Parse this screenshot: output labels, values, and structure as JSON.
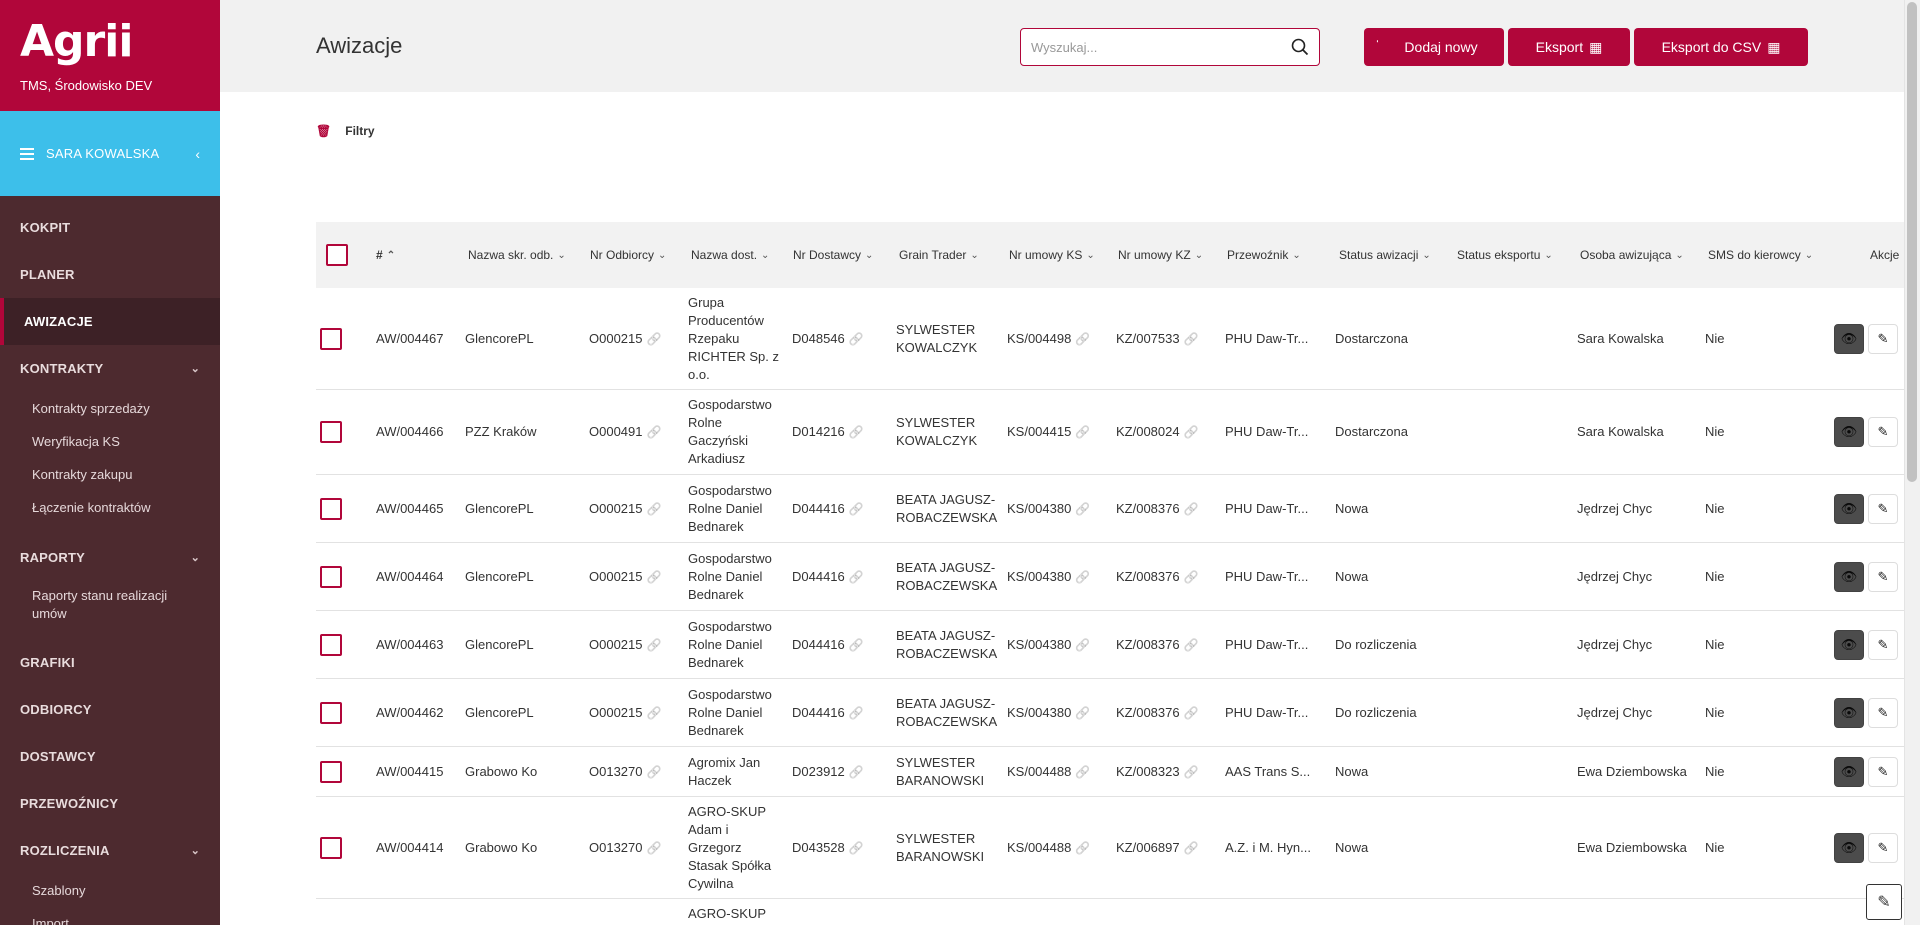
{
  "brand": {
    "logo": "Agrii",
    "env": "TMS, Środowisko DEV",
    "accent": "#b1063a",
    "user_bar_color": "#3dbfea",
    "sidebar_color": "#4d2a2f"
  },
  "user": {
    "name": "SARA KOWALSKA"
  },
  "nav": {
    "kokpit": "KOKPIT",
    "planer": "PLANER",
    "awizacje": "AWIZACJE",
    "kontrakty": "KONTRAKTY",
    "kontrakty_sub": [
      "Kontrakty sprzedaży",
      "Weryfikacja KS",
      "Kontrakty zakupu",
      "Łączenie kontraktów"
    ],
    "raporty": "RAPORTY",
    "raporty_sub": [
      "Raporty stanu realizacji umów"
    ],
    "grafiki": "GRAFIKI",
    "odbiorcy": "ODBIORCY",
    "dostawcy": "DOSTAWCY",
    "przewoznicy": "PRZEWOŹNICY",
    "rozliczenia": "ROZLICZENIA",
    "rozliczenia_sub": [
      "Szablony",
      "Import"
    ]
  },
  "header": {
    "title": "Awizacje",
    "search_placeholder": "Wyszukaj...",
    "add_label": "Dodaj nowy",
    "export_label": "Eksport",
    "export_csv_label": "Eksport do CSV"
  },
  "filters": {
    "label": "Filtry"
  },
  "table": {
    "columns": [
      "#",
      "Nazwa skr. odb.",
      "Nr Odbiorcy",
      "Nazwa dost.",
      "Nr Dostawcy",
      "Grain Trader",
      "Nr umowy KS",
      "Nr umowy KZ",
      "Przewoźnik",
      "Status awizacji",
      "Status eksportu",
      "Osoba awizująca",
      "SMS do kierowcy",
      "Akcje"
    ],
    "rows": [
      {
        "id": "AW/004467",
        "odb": "GlencorePL",
        "nr_odb": "O000215",
        "dost": "Grupa Producentów Rzepaku RICHTER Sp. z o.o.",
        "nr_dost": "D048546",
        "trader": "SYLWESTER KOWALCZYK",
        "ks": "KS/004498",
        "kz": "KZ/007533",
        "przew": "PHU Daw-Tr...",
        "status": "Dostarczona",
        "eksport": "",
        "osoba": "Sara Kowalska",
        "sms": "Nie"
      },
      {
        "id": "AW/004466",
        "odb": "PZZ Kraków",
        "nr_odb": "O000491",
        "dost": "Gospodarstwo Rolne Gaczyński Arkadiusz",
        "nr_dost": "D014216",
        "trader": "SYLWESTER KOWALCZYK",
        "ks": "KS/004415",
        "kz": "KZ/008024",
        "przew": "PHU Daw-Tr...",
        "status": "Dostarczona",
        "eksport": "",
        "osoba": "Sara Kowalska",
        "sms": "Nie"
      },
      {
        "id": "AW/004465",
        "odb": "GlencorePL",
        "nr_odb": "O000215",
        "dost": "Gospodarstwo Rolne Daniel Bednarek",
        "nr_dost": "D044416",
        "trader": "BEATA JAGUSZ-ROBACZEWSKA",
        "ks": "KS/004380",
        "kz": "KZ/008376",
        "przew": "PHU Daw-Tr...",
        "status": "Nowa",
        "eksport": "",
        "osoba": "Jędrzej Chyc",
        "sms": "Nie"
      },
      {
        "id": "AW/004464",
        "odb": "GlencorePL",
        "nr_odb": "O000215",
        "dost": "Gospodarstwo Rolne Daniel Bednarek",
        "nr_dost": "D044416",
        "trader": "BEATA JAGUSZ-ROBACZEWSKA",
        "ks": "KS/004380",
        "kz": "KZ/008376",
        "przew": "PHU Daw-Tr...",
        "status": "Nowa",
        "eksport": "",
        "osoba": "Jędrzej Chyc",
        "sms": "Nie"
      },
      {
        "id": "AW/004463",
        "odb": "GlencorePL",
        "nr_odb": "O000215",
        "dost": "Gospodarstwo Rolne Daniel Bednarek",
        "nr_dost": "D044416",
        "trader": "BEATA JAGUSZ-ROBACZEWSKA",
        "ks": "KS/004380",
        "kz": "KZ/008376",
        "przew": "PHU Daw-Tr...",
        "status": "Do rozliczenia",
        "eksport": "",
        "osoba": "Jędrzej Chyc",
        "sms": "Nie"
      },
      {
        "id": "AW/004462",
        "odb": "GlencorePL",
        "nr_odb": "O000215",
        "dost": "Gospodarstwo Rolne Daniel Bednarek",
        "nr_dost": "D044416",
        "trader": "BEATA JAGUSZ-ROBACZEWSKA",
        "ks": "KS/004380",
        "kz": "KZ/008376",
        "przew": "PHU Daw-Tr...",
        "status": "Do rozliczenia",
        "eksport": "",
        "osoba": "Jędrzej Chyc",
        "sms": "Nie"
      },
      {
        "id": "AW/004415",
        "odb": "Grabowo Ko",
        "nr_odb": "O013270",
        "dost": "Agromix Jan Haczek",
        "nr_dost": "D023912",
        "trader": "SYLWESTER BARANOWSKI",
        "ks": "KS/004488",
        "kz": "KZ/008323",
        "przew": "AAS Trans S...",
        "status": "Nowa",
        "eksport": "",
        "osoba": "Ewa Dziembowska",
        "sms": "Nie"
      },
      {
        "id": "AW/004414",
        "odb": "Grabowo Ko",
        "nr_odb": "O013270",
        "dost": "AGRO-SKUP Adam i Grzegorz Stasak Spółka Cywilna",
        "nr_dost": "D043528",
        "trader": "SYLWESTER BARANOWSKI",
        "ks": "KS/004488",
        "kz": "KZ/006897",
        "przew": "A.Z. i M. Hyn...",
        "status": "Nowa",
        "eksport": "",
        "osoba": "Ewa Dziembowska",
        "sms": "Nie"
      },
      {
        "id": "",
        "odb": "",
        "nr_odb": "",
        "dost": "AGRO-SKUP",
        "nr_dost": "",
        "trader": "",
        "ks": "",
        "kz": "",
        "przew": "",
        "status": "",
        "eksport": "",
        "osoba": "",
        "sms": ""
      }
    ]
  }
}
